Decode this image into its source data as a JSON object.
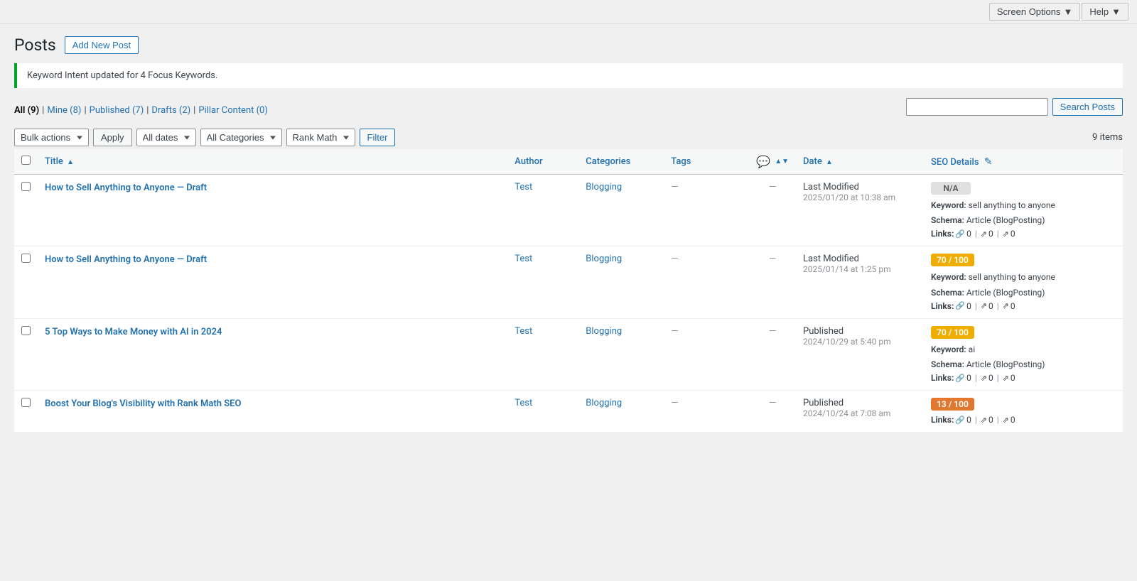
{
  "topbar": {
    "screen_options": "Screen Options",
    "help": "Help"
  },
  "page": {
    "title": "Posts",
    "add_new_label": "Add New Post"
  },
  "notice": {
    "message": "Keyword Intent updated for 4 Focus Keywords."
  },
  "subnav": {
    "items": [
      {
        "label": "All (9)",
        "key": "all",
        "active": true
      },
      {
        "label": "Mine (8)",
        "key": "mine",
        "active": false
      },
      {
        "label": "Published (7)",
        "key": "published",
        "active": false
      },
      {
        "label": "Drafts (2)",
        "key": "drafts",
        "active": false
      },
      {
        "label": "Pillar Content (0)",
        "key": "pillar",
        "active": false
      }
    ]
  },
  "search": {
    "placeholder": "",
    "button_label": "Search Posts"
  },
  "toolbar": {
    "bulk_actions": "Bulk actions",
    "apply_label": "Apply",
    "all_dates": "All dates",
    "all_categories": "All Categories",
    "rank_math": "Rank Math",
    "filter_label": "Filter",
    "items_count": "9 items"
  },
  "table": {
    "columns": {
      "title": "Title",
      "author": "Author",
      "categories": "Categories",
      "tags": "Tags",
      "comments": "comments",
      "date": "Date",
      "seo": "SEO Details"
    },
    "rows": [
      {
        "id": 1,
        "title": "How to Sell Anything to Anyone — Draft",
        "author": "Test",
        "categories": "Blogging",
        "tags": "—",
        "comments": "—",
        "date_status": "Last Modified",
        "date_value": "2025/01/20 at 10:38 am",
        "seo_badge": "N/A",
        "seo_badge_type": "na",
        "seo_keyword": "sell anything to anyone",
        "seo_schema": "Article (BlogPosting)",
        "seo_links_internal": "0",
        "seo_links_external": "0",
        "seo_links_affiliate": "0"
      },
      {
        "id": 2,
        "title": "How to Sell Anything to Anyone — Draft",
        "author": "Test",
        "categories": "Blogging",
        "tags": "—",
        "comments": "—",
        "date_status": "Last Modified",
        "date_value": "2025/01/14 at 1:25 pm",
        "seo_badge": "70 / 100",
        "seo_badge_type": "yellow",
        "seo_keyword": "sell anything to anyone",
        "seo_schema": "Article (BlogPosting)",
        "seo_links_internal": "0",
        "seo_links_external": "0",
        "seo_links_affiliate": "0"
      },
      {
        "id": 3,
        "title": "5 Top Ways to Make Money with AI in 2024",
        "author": "Test",
        "categories": "Blogging",
        "tags": "—",
        "comments": "—",
        "date_status": "Published",
        "date_value": "2024/10/29 at 5:40 pm",
        "seo_badge": "70 / 100",
        "seo_badge_type": "yellow",
        "seo_keyword": "ai",
        "seo_schema": "Article (BlogPosting)",
        "seo_links_internal": "0",
        "seo_links_external": "0",
        "seo_links_affiliate": "0"
      },
      {
        "id": 4,
        "title": "Boost Your Blog's Visibility with Rank Math SEO",
        "author": "Test",
        "categories": "Blogging",
        "tags": "—",
        "comments": "—",
        "date_status": "Published",
        "date_value": "2024/10/24 at 7:08 am",
        "seo_badge": "13 / 100",
        "seo_badge_type": "orange",
        "seo_keyword": "",
        "seo_schema": "",
        "seo_links_internal": "0",
        "seo_links_external": "0",
        "seo_links_affiliate": "0"
      }
    ]
  }
}
